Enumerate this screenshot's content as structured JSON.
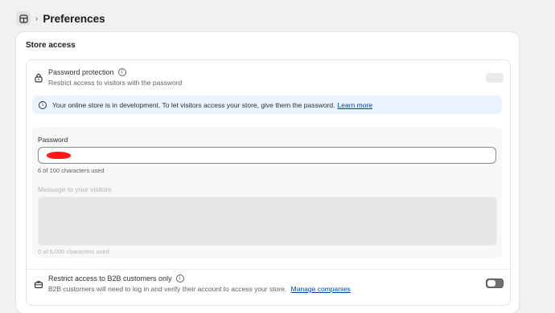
{
  "header": {
    "title": "Preferences",
    "nav_icon": "store-layout-icon"
  },
  "store_access": {
    "title": "Store access",
    "password_protection": {
      "label": "Password protection",
      "description": "Restrict access to visitors with the password",
      "enabled": false
    },
    "banner": {
      "text": "Your online store is in development. To let visitors access your store, give them the password.",
      "link": "Learn more"
    },
    "password": {
      "label": "Password",
      "value_redacted": true,
      "count": "6 of 100 characters used"
    },
    "message": {
      "label": "Message to your visitors",
      "count": "0 of 5,000 characters used"
    },
    "b2b": {
      "label": "Restrict access to B2B customers only",
      "description": "B2B customers will need to log in and verify their account to access your store.",
      "link": "Manage companies",
      "enabled": false
    }
  },
  "colors": {
    "banner_bg": "#eaf4ff",
    "link": "#004299",
    "redaction": "#ff1a1a"
  }
}
